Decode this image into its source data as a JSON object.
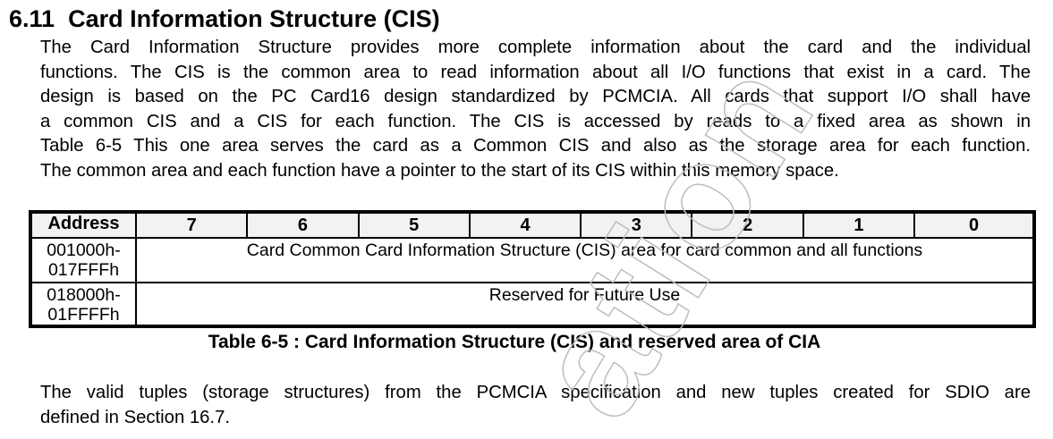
{
  "heading": {
    "number": "6.11",
    "title": "Card Information Structure (CIS)"
  },
  "paragraph1": [
    "The Card Information Structure provides more complete information about the card and the individual",
    "functions. The CIS is the common area to read information about all I/O functions that exist in a card. The",
    "design is based on the PC Card16 design standardized by PCMCIA. All cards that support I/O shall have",
    "a common CIS and a CIS for each function. The CIS is accessed by reads to a fixed area as shown in",
    "Table 6-5 This one area serves the card as a Common CIS and also as the storage area for each function.",
    "The common area and each function have a pointer to the start of its CIS within this memory space."
  ],
  "table": {
    "headers": [
      "Address",
      "7",
      "6",
      "5",
      "4",
      "3",
      "2",
      "1",
      "0"
    ],
    "rows": [
      {
        "address": [
          "001000h-",
          "017FFFh"
        ],
        "content": "Card Common Card Information Structure (CIS) area for card common and all functions"
      },
      {
        "address": [
          "018000h-",
          "01FFFFh"
        ],
        "content": "Reserved for Future Use"
      }
    ],
    "caption": "Table 6-5 : Card Information Structure (CIS) and reserved area of CIA"
  },
  "paragraph2": [
    "The valid tuples (storage structures) from the PCMCIA specification and new tuples created for SDIO are",
    "defined in Section 16.7."
  ],
  "watermark": "ation"
}
